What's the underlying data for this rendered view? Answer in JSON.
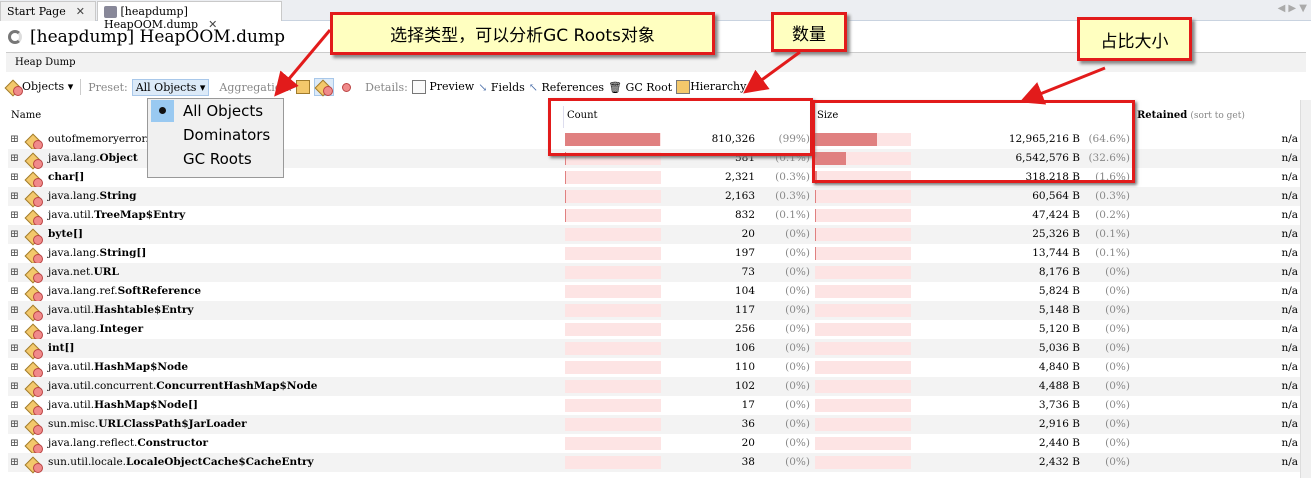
{
  "tabs": [
    {
      "label": "Start Page"
    },
    {
      "label": "[heapdump] HeapOOM.dump"
    }
  ],
  "title": "[heapdump] HeapOOM.dump",
  "subheader": "Heap Dump",
  "toolbar": {
    "objects": "Objects",
    "preset_label": "Preset:",
    "preset_value": "All Objects",
    "aggregation_label": "Aggregation:",
    "details_label": "Details:",
    "preview": "Preview",
    "fields": "Fields",
    "references": "References",
    "gc_root": "GC Root",
    "hierarchy": "Hierarchy"
  },
  "preset_options": [
    "All Objects",
    "Dominators",
    "GC Roots"
  ],
  "columns": {
    "name": "Name",
    "count": "Count",
    "size": "Size",
    "retained": "Retained",
    "retained_hint": "(sort to get)"
  },
  "rows": [
    {
      "pkg": "outofmemoryerror.",
      "cls": "",
      "count": "810,326",
      "count_pct": "(99%)",
      "count_frac": 0.99,
      "size": "12,965,216 B",
      "size_pct": "(64.6%)",
      "size_frac": 0.646,
      "retained": "n/a"
    },
    {
      "pkg": "java.lang.",
      "cls": "Object",
      "count": "581",
      "count_pct": "(0.1%)",
      "count_frac": 0.001,
      "size": "6,542,576 B",
      "size_pct": "(32.6%)",
      "size_frac": 0.326,
      "retained": "n/a"
    },
    {
      "pkg": "",
      "cls": "char[]",
      "count": "2,321",
      "count_pct": "(0.3%)",
      "count_frac": 0.003,
      "size": "318,218 B",
      "size_pct": "(1.6%)",
      "size_frac": 0.016,
      "retained": "n/a"
    },
    {
      "pkg": "java.lang.",
      "cls": "String",
      "count": "2,163",
      "count_pct": "(0.3%)",
      "count_frac": 0.003,
      "size": "60,564 B",
      "size_pct": "(0.3%)",
      "size_frac": 0.003,
      "retained": "n/a"
    },
    {
      "pkg": "java.util.",
      "cls": "TreeMap$Entry",
      "count": "832",
      "count_pct": "(0.1%)",
      "count_frac": 0.001,
      "size": "47,424 B",
      "size_pct": "(0.2%)",
      "size_frac": 0.002,
      "retained": "n/a"
    },
    {
      "pkg": "",
      "cls": "byte[]",
      "count": "20",
      "count_pct": "(0%)",
      "count_frac": 0,
      "size": "25,326 B",
      "size_pct": "(0.1%)",
      "size_frac": 0.001,
      "retained": "n/a"
    },
    {
      "pkg": "java.lang.",
      "cls": "String[]",
      "count": "197",
      "count_pct": "(0%)",
      "count_frac": 0,
      "size": "13,744 B",
      "size_pct": "(0.1%)",
      "size_frac": 0.001,
      "retained": "n/a"
    },
    {
      "pkg": "java.net.",
      "cls": "URL",
      "count": "73",
      "count_pct": "(0%)",
      "count_frac": 0,
      "size": "8,176 B",
      "size_pct": "(0%)",
      "size_frac": 0,
      "retained": "n/a"
    },
    {
      "pkg": "java.lang.ref.",
      "cls": "SoftReference",
      "count": "104",
      "count_pct": "(0%)",
      "count_frac": 0,
      "size": "5,824 B",
      "size_pct": "(0%)",
      "size_frac": 0,
      "retained": "n/a"
    },
    {
      "pkg": "java.util.",
      "cls": "Hashtable$Entry",
      "count": "117",
      "count_pct": "(0%)",
      "count_frac": 0,
      "size": "5,148 B",
      "size_pct": "(0%)",
      "size_frac": 0,
      "retained": "n/a"
    },
    {
      "pkg": "java.lang.",
      "cls": "Integer",
      "count": "256",
      "count_pct": "(0%)",
      "count_frac": 0,
      "size": "5,120 B",
      "size_pct": "(0%)",
      "size_frac": 0,
      "retained": "n/a"
    },
    {
      "pkg": "",
      "cls": "int[]",
      "count": "106",
      "count_pct": "(0%)",
      "count_frac": 0,
      "size": "5,036 B",
      "size_pct": "(0%)",
      "size_frac": 0,
      "retained": "n/a"
    },
    {
      "pkg": "java.util.",
      "cls": "HashMap$Node",
      "count": "110",
      "count_pct": "(0%)",
      "count_frac": 0,
      "size": "4,840 B",
      "size_pct": "(0%)",
      "size_frac": 0,
      "retained": "n/a"
    },
    {
      "pkg": "java.util.concurrent.",
      "cls": "ConcurrentHashMap$Node",
      "count": "102",
      "count_pct": "(0%)",
      "count_frac": 0,
      "size": "4,488 B",
      "size_pct": "(0%)",
      "size_frac": 0,
      "retained": "n/a"
    },
    {
      "pkg": "java.util.",
      "cls": "HashMap$Node[]",
      "count": "17",
      "count_pct": "(0%)",
      "count_frac": 0,
      "size": "3,736 B",
      "size_pct": "(0%)",
      "size_frac": 0,
      "retained": "n/a"
    },
    {
      "pkg": "sun.misc.",
      "cls": "URLClassPath$JarLoader",
      "count": "36",
      "count_pct": "(0%)",
      "count_frac": 0,
      "size": "2,916 B",
      "size_pct": "(0%)",
      "size_frac": 0,
      "retained": "n/a"
    },
    {
      "pkg": "java.lang.reflect.",
      "cls": "Constructor",
      "count": "20",
      "count_pct": "(0%)",
      "count_frac": 0,
      "size": "2,440 B",
      "size_pct": "(0%)",
      "size_frac": 0,
      "retained": "n/a"
    },
    {
      "pkg": "sun.util.locale.",
      "cls": "LocaleObjectCache$CacheEntry",
      "count": "38",
      "count_pct": "(0%)",
      "count_frac": 0,
      "size": "2,432 B",
      "size_pct": "(0%)",
      "size_frac": 0,
      "retained": "n/a"
    }
  ],
  "annotations": {
    "select_type": "选择类型，可以分析GC Roots对象",
    "count": "数量",
    "size_ratio": "占比大小"
  },
  "colors": {
    "bar_fill": "#e08080",
    "bar_bg": "#fde4e4",
    "callout_border": "#e21b1b",
    "callout_bg": "#ffffc0"
  }
}
